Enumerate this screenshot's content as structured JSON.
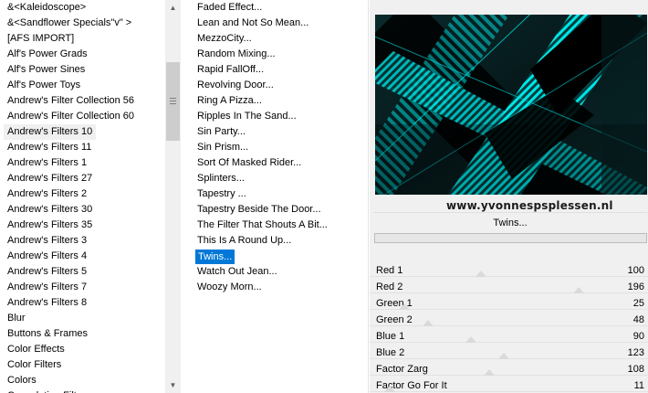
{
  "categories": [
    "&<Kaleidoscope>",
    "&<Sandflower Specials\"v\" >",
    "[AFS IMPORT]",
    "Alf's Power Grads",
    "Alf's Power Sines",
    "Alf's Power Toys",
    "Andrew's Filter Collection 56",
    "Andrew's Filter Collection 60",
    "Andrew's Filters 10",
    "Andrew's Filters 11",
    "Andrew's Filters 1",
    "Andrew's Filters 27",
    "Andrew's Filters 2",
    "Andrew's Filters 30",
    "Andrew's Filters 35",
    "Andrew's Filters 3",
    "Andrew's Filters 4",
    "Andrew's Filters 5",
    "Andrew's Filters 7",
    "Andrew's Filters 8",
    "Blur",
    "Buttons & Frames",
    "Color Effects",
    "Color Filters",
    "Colors",
    "Convolution Filters"
  ],
  "selected_category": "Andrew's Filters 10",
  "filters": [
    "Faded Effect...",
    "Lean and Not So Mean...",
    "MezzoCity...",
    "Random Mixing...",
    "Rapid FallOff...",
    "Revolving Door...",
    "Ring A Pizza...",
    "Ripples In The Sand...",
    "Sin Party...",
    "Sin Prism...",
    "Sort Of Masked Rider...",
    "Splinters...",
    "Tapestry ...",
    "Tapestry Beside The Door...",
    "The Filter That Shouts A Bit...",
    "This Is A Round Up...",
    "Twins...",
    "Watch Out Jean...",
    "Woozy Morn..."
  ],
  "selected_filter": "Twins...",
  "preview": {
    "watermark": "www.yvonnespsplessen.nl",
    "accent_color": "#00e5e5"
  },
  "current_filter_name": "Twins...",
  "params": [
    {
      "label": "Red 1",
      "value": "100"
    },
    {
      "label": "Red 2",
      "value": "196"
    },
    {
      "label": "Green 1",
      "value": "25"
    },
    {
      "label": "Green 2",
      "value": "48"
    },
    {
      "label": "Blue 1",
      "value": "90"
    },
    {
      "label": "Blue 2",
      "value": "123"
    },
    {
      "label": "Factor Zarg",
      "value": "108"
    },
    {
      "label": "Factor Go For It",
      "value": "11"
    }
  ],
  "icons": {
    "scroll_up": "▲",
    "scroll_down": "▼"
  }
}
